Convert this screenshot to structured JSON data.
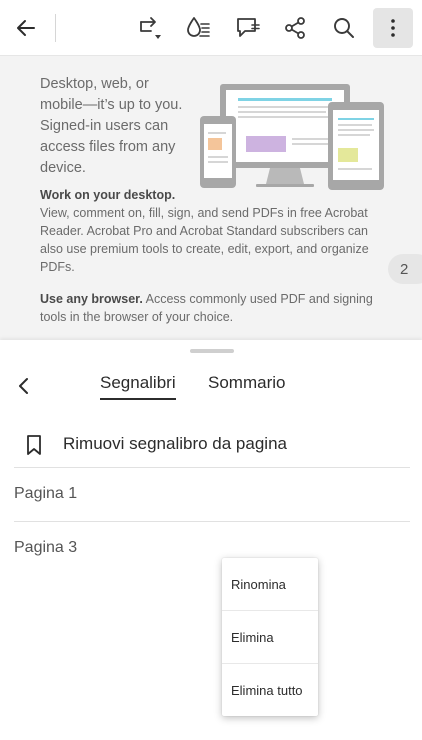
{
  "toolbar": {
    "buttons": [
      "back-icon",
      "share-export-icon",
      "ink-fill-icon",
      "comment-icon",
      "share-icon",
      "search-icon",
      "more-vertical-icon"
    ]
  },
  "document": {
    "intro": "Desktop, web, or mobile—it’s up to you. Signed-in users can access files from any device.",
    "section1_lead": "Work on your desktop.",
    "section1_body": "View, comment on, fill, sign, and send PDFs in free Acrobat Reader. Acrobat Pro and Acrobat Standard subscribers can also use premium tools to create, edit, export, and organize PDFs.",
    "section2_lead": "Use any browser.",
    "section2_body": "Access commonly used PDF and signing tools in the browser of your choice.",
    "page_number": "2"
  },
  "sheet": {
    "tabs": {
      "bookmarks": "Segnalibri",
      "toc": "Sommario"
    },
    "remove_bookmark_label": "Rimuovi segnalibro da pagina",
    "bookmarks": [
      "Pagina 1",
      "Pagina 3"
    ]
  },
  "context_menu": {
    "items": [
      "Rinomina",
      "Elimina",
      "Elimina tutto"
    ]
  }
}
